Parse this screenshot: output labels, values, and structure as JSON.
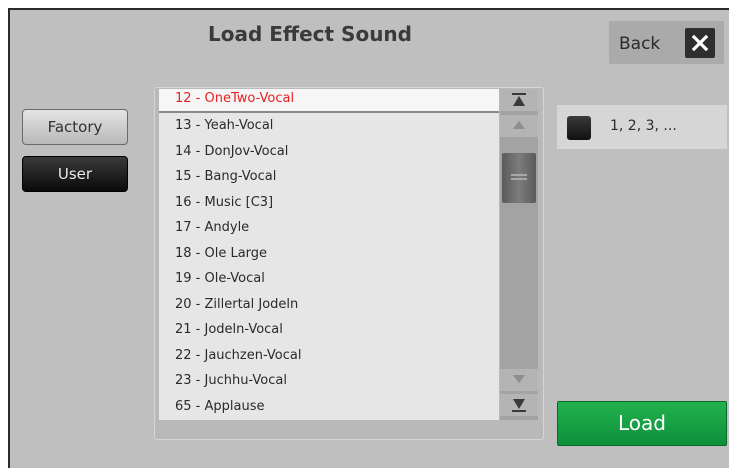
{
  "header": {
    "title": "Load Effect Sound",
    "back_label": "Back"
  },
  "sidebar": {
    "factory_label": "Factory",
    "user_label": "User"
  },
  "list": {
    "items": [
      "12 - OneTwo-Vocal",
      "13 - Yeah-Vocal",
      "14 - DonJov-Vocal",
      "15 - Bang-Vocal",
      "16 - Music [C3]",
      "17 - Andyle",
      "18 - Ole Large",
      "19 - Ole-Vocal",
      "20 - Zillertal Jodeln",
      "21 - Jodeln-Vocal",
      "22 - Jauchzen-Vocal",
      "23 - Juchhu-Vocal",
      "65 - Applause"
    ],
    "selected_index": 0
  },
  "options": {
    "numbering_label": "1, 2, 3, ..."
  },
  "actions": {
    "load_label": "Load"
  },
  "colors": {
    "selected_text": "#e82020",
    "load_green": "#1aa446"
  }
}
